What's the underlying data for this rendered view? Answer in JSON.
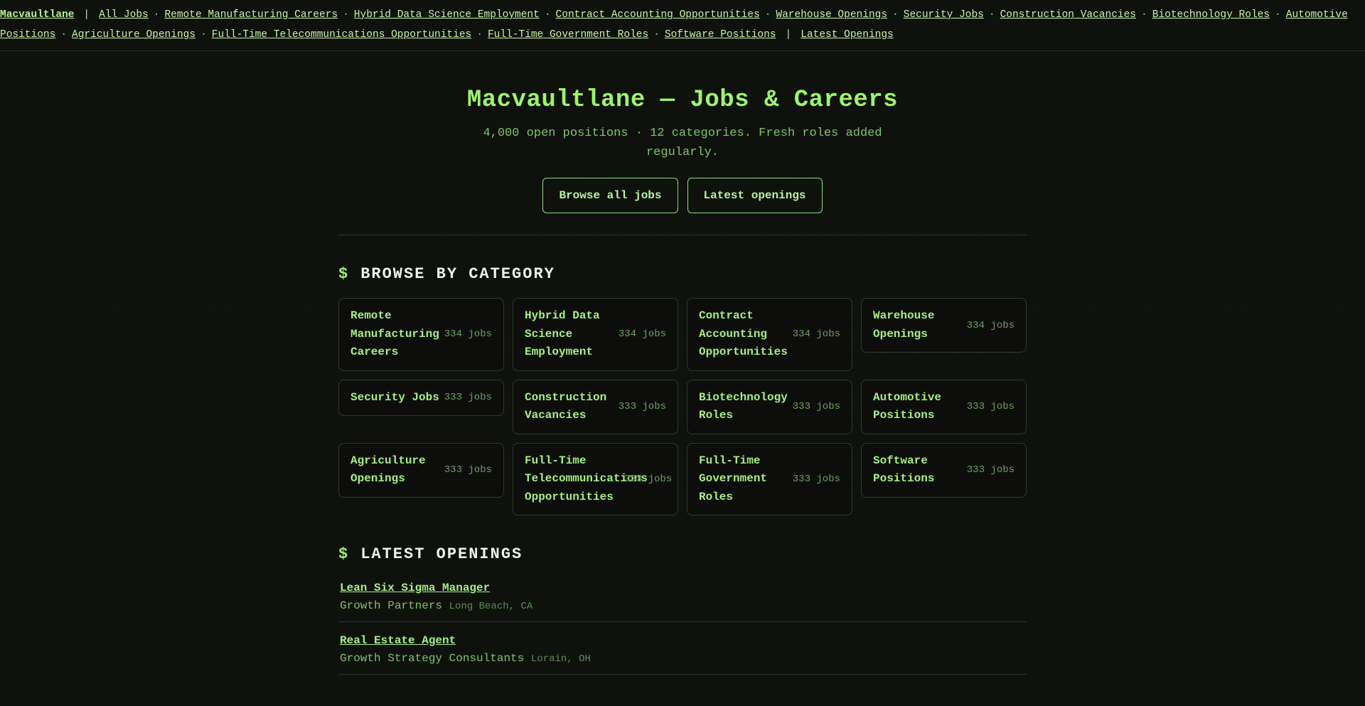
{
  "nav": {
    "brand": "Macvaultlane",
    "all_jobs": "All Jobs",
    "categories": [
      "Remote Manufacturing Careers",
      "Hybrid Data Science Employment",
      "Contract Accounting Opportunities",
      "Warehouse Openings",
      "Security Jobs",
      "Construction Vacancies",
      "Biotechnology Roles",
      "Automotive Positions",
      "Agriculture Openings",
      "Full-Time Telecommunications Opportunities",
      "Full-Time Government Roles",
      "Software Positions"
    ],
    "latest": "Latest Openings",
    "separator": "|",
    "dot": "·"
  },
  "hero": {
    "title": "Macvaultlane — Jobs & Careers",
    "subtitle": "4,000 open positions · 12 categories. Fresh roles added regularly.",
    "browse_button": "Browse all jobs",
    "latest_button": "Latest openings"
  },
  "browse": {
    "prefix": "$",
    "heading": "BROWSE BY CATEGORY",
    "cards": [
      {
        "name": "Remote Manufacturing Careers",
        "count": "334 jobs"
      },
      {
        "name": "Hybrid Data Science Employment",
        "count": "334 jobs"
      },
      {
        "name": "Contract Accounting Opportunities",
        "count": "334 jobs"
      },
      {
        "name": "Warehouse Openings",
        "count": "334 jobs"
      },
      {
        "name": "Security Jobs",
        "count": "333 jobs"
      },
      {
        "name": "Construction Vacancies",
        "count": "333 jobs"
      },
      {
        "name": "Biotechnology Roles",
        "count": "333 jobs"
      },
      {
        "name": "Automotive Positions",
        "count": "333 jobs"
      },
      {
        "name": "Agriculture Openings",
        "count": "333 jobs"
      },
      {
        "name": "Full-Time Telecommunications Opportunities",
        "count": "333 jobs"
      },
      {
        "name": "Full-Time Government Roles",
        "count": "333 jobs"
      },
      {
        "name": "Software Positions",
        "count": "333 jobs"
      }
    ]
  },
  "latest": {
    "prefix": "$",
    "heading": "LATEST OPENINGS",
    "items": [
      {
        "title": "Lean Six Sigma Manager",
        "company": "Growth Partners",
        "location": "Long Beach, CA"
      },
      {
        "title": "Real Estate Agent",
        "company": "Growth Strategy Consultants",
        "location": "Lorain, OH"
      }
    ]
  },
  "colors": {
    "background": "#0d0f0b",
    "accent": "#9df36e",
    "link": "#a6ef83",
    "muted": "#6f9e62",
    "heading": "#eef3ea"
  }
}
